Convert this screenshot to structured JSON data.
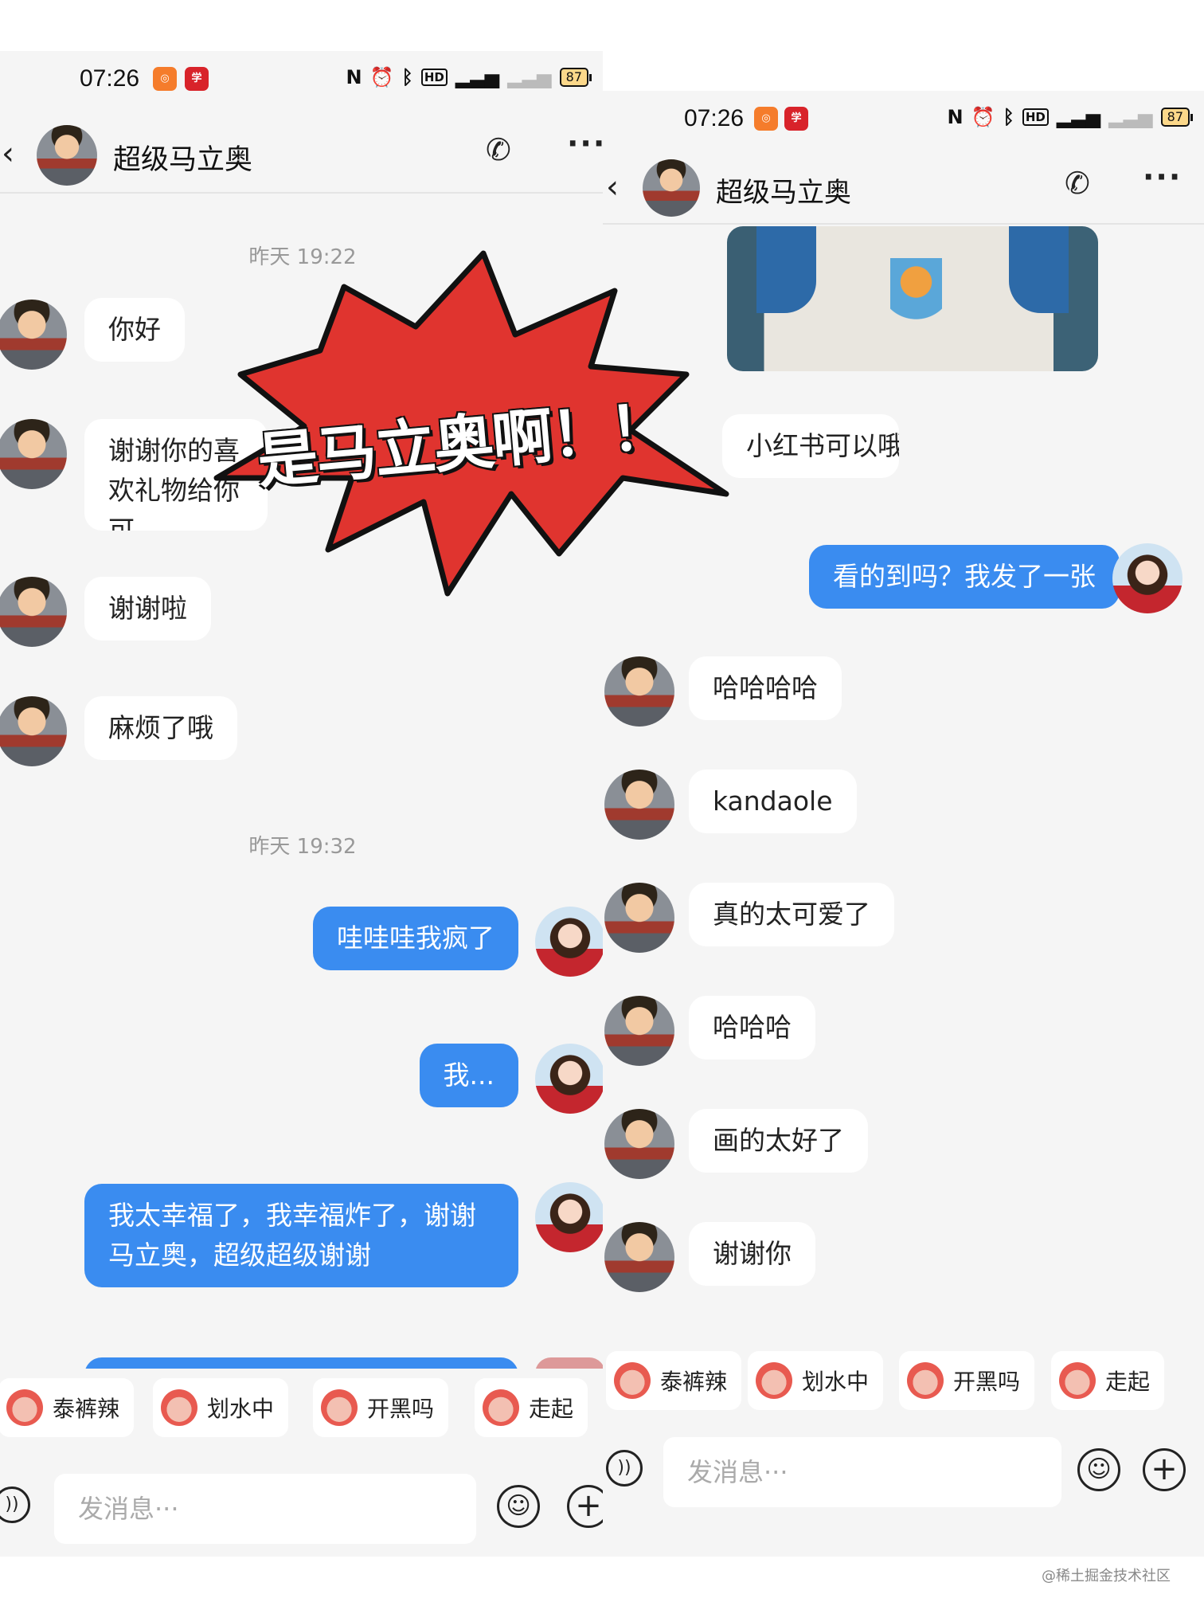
{
  "left": {
    "status": {
      "time": "07:26",
      "battery": "87"
    },
    "header": {
      "contact_name": "超级马立奥"
    },
    "timestamps": [
      "昨天 19:22",
      "昨天 19:32"
    ],
    "messages": [
      {
        "side": "in",
        "text": "你好"
      },
      {
        "side": "in",
        "text": "谢谢你的喜欢礼物给你可"
      },
      {
        "side": "in",
        "text": "谢谢啦"
      },
      {
        "side": "in",
        "text": "麻烦了哦"
      },
      {
        "side": "out",
        "text": "哇哇哇我疯了"
      },
      {
        "side": "out",
        "text": "我..."
      },
      {
        "side": "out",
        "text": "我太幸福了，我幸福炸了，谢谢马立奥，超级超级谢谢"
      }
    ],
    "quick_replies": [
      "泰裤辣",
      "划水中",
      "开黑吗",
      "走起"
    ],
    "input_placeholder": "发消息···"
  },
  "right": {
    "status": {
      "time": "07:26",
      "battery": "87"
    },
    "header": {
      "contact_name": "超级马立奥"
    },
    "messages": [
      {
        "side": "in",
        "text": "小红书可以哦"
      },
      {
        "side": "out",
        "text": "看的到吗？我发了一张"
      },
      {
        "side": "in",
        "text": "哈哈哈哈"
      },
      {
        "side": "in",
        "text": "kandaole"
      },
      {
        "side": "in",
        "text": "真的太可爱了"
      },
      {
        "side": "in",
        "text": "哈哈哈"
      },
      {
        "side": "in",
        "text": "画的太好了"
      },
      {
        "side": "in",
        "text": "谢谢你"
      }
    ],
    "quick_replies": [
      "泰裤辣",
      "划水中",
      "开黑吗",
      "走起"
    ],
    "input_placeholder": "发消息···"
  },
  "overlay": {
    "burst_text": "是马立奥啊！！",
    "burst_color": "#e0342f"
  },
  "watermark": "@稀土掘金技术社区",
  "colors": {
    "out_bubble": "#3a8cf0",
    "in_bubble": "#ffffff",
    "background": "#f5f5f5"
  },
  "icons": [
    "back-icon",
    "phone-icon",
    "more-icon",
    "voice-icon",
    "emoji-icon",
    "plus-icon",
    "nfc-icon",
    "alarm-icon",
    "bluetooth-icon",
    "hd-icon",
    "signal-icon",
    "battery-icon"
  ]
}
